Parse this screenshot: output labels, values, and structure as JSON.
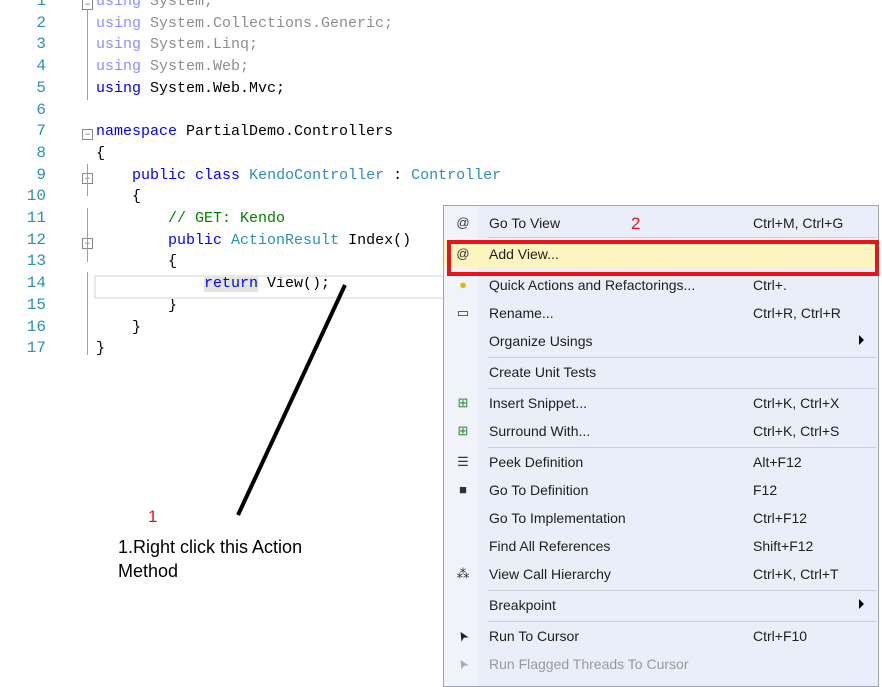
{
  "editor": {
    "lines": [
      {
        "n": "1",
        "tokens": [
          [
            "using",
            "kw dim"
          ],
          [
            " System;",
            "dim"
          ]
        ]
      },
      {
        "n": "2",
        "tokens": [
          [
            "using",
            "kw dim"
          ],
          [
            " System.Collections.Generic;",
            "dim"
          ]
        ]
      },
      {
        "n": "3",
        "tokens": [
          [
            "using",
            "kw dim"
          ],
          [
            " System.Linq;",
            "dim"
          ]
        ]
      },
      {
        "n": "4",
        "tokens": [
          [
            "using",
            "kw dim"
          ],
          [
            " System.Web;",
            "dim"
          ]
        ]
      },
      {
        "n": "5",
        "tokens": [
          [
            "using",
            "kw"
          ],
          [
            " System.Web.Mvc;",
            ""
          ]
        ]
      },
      {
        "n": "6",
        "tokens": []
      },
      {
        "n": "7",
        "tokens": [
          [
            "namespace",
            "kw"
          ],
          [
            " PartialDemo.Controllers",
            ""
          ]
        ]
      },
      {
        "n": "8",
        "tokens": [
          [
            "{",
            ""
          ]
        ]
      },
      {
        "n": "9",
        "tokens": [
          [
            "    ",
            ""
          ],
          [
            "public",
            "kw"
          ],
          [
            " ",
            ""
          ],
          [
            "class",
            "kw"
          ],
          [
            " ",
            ""
          ],
          [
            "KendoController",
            "ty"
          ],
          [
            " : ",
            ""
          ],
          [
            "Controller",
            "ty"
          ]
        ]
      },
      {
        "n": "10",
        "tokens": [
          [
            "    {",
            ""
          ]
        ]
      },
      {
        "n": "11",
        "tokens": [
          [
            "        ",
            ""
          ],
          [
            "// GET: Kendo",
            "cm"
          ]
        ]
      },
      {
        "n": "12",
        "tokens": [
          [
            "        ",
            ""
          ],
          [
            "public",
            "kw"
          ],
          [
            " ",
            ""
          ],
          [
            "ActionResult",
            "ty"
          ],
          [
            " Index()",
            ""
          ]
        ]
      },
      {
        "n": "13",
        "tokens": [
          [
            "        {",
            ""
          ]
        ]
      },
      {
        "n": "14",
        "tokens": [
          [
            "            ",
            ""
          ],
          [
            "return",
            "kw hl"
          ],
          [
            " View();",
            ""
          ]
        ]
      },
      {
        "n": "15",
        "tokens": [
          [
            "        }",
            ""
          ]
        ]
      },
      {
        "n": "16",
        "tokens": [
          [
            "    }",
            ""
          ]
        ]
      },
      {
        "n": "17",
        "tokens": [
          [
            "}",
            ""
          ]
        ]
      }
    ]
  },
  "context_menu": {
    "items": [
      {
        "label": "Go To View",
        "shortcut": "Ctrl+M, Ctrl+G",
        "icon": "razor-view-icon"
      },
      {
        "label": "Add View...",
        "shortcut": "",
        "icon": "razor-view-icon",
        "selected": true
      },
      {
        "label": "Quick Actions and Refactorings...",
        "shortcut": "Ctrl+.",
        "icon": "lightbulb-icon"
      },
      {
        "label": "Rename...",
        "shortcut": "Ctrl+R, Ctrl+R",
        "icon": "rename-icon"
      },
      {
        "label": "Organize Usings",
        "shortcut": "",
        "submenu": true,
        "sep_after": true
      },
      {
        "label": "Create Unit Tests",
        "shortcut": "",
        "sep_after": true
      },
      {
        "label": "Insert Snippet...",
        "shortcut": "Ctrl+K, Ctrl+X",
        "icon": "snippet-icon"
      },
      {
        "label": "Surround With...",
        "shortcut": "Ctrl+K, Ctrl+S",
        "icon": "snippet-icon",
        "sep_after": true
      },
      {
        "label": "Peek Definition",
        "shortcut": "Alt+F12",
        "icon": "peek-icon"
      },
      {
        "label": "Go To Definition",
        "shortcut": "F12",
        "icon": "go-to-definition-icon"
      },
      {
        "label": "Go To Implementation",
        "shortcut": "Ctrl+F12"
      },
      {
        "label": "Find All References",
        "shortcut": "Shift+F12"
      },
      {
        "label": "View Call Hierarchy",
        "shortcut": "Ctrl+K, Ctrl+T",
        "icon": "call-hierarchy-icon",
        "sep_after": true
      },
      {
        "label": "Breakpoint",
        "shortcut": "",
        "submenu": true,
        "sep_after": true
      },
      {
        "label": "Run To Cursor",
        "shortcut": "Ctrl+F10",
        "icon": "cursor-icon"
      },
      {
        "label": "Run Flagged Threads To Cursor",
        "shortcut": "",
        "icon": "cursor-icon",
        "disabled": true
      }
    ]
  },
  "annotations": {
    "step1_number": "1",
    "step2_number": "2",
    "note": "1.Right click this Action Method"
  },
  "colors": {
    "highlight": "#e8141b",
    "menu_bg": "#e9eef9",
    "selected_bg": "#fdf4bf"
  }
}
